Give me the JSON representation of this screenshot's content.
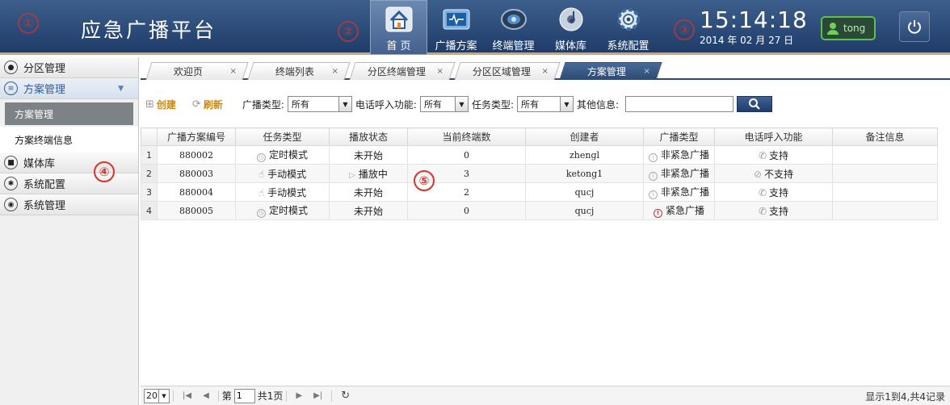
{
  "header": {
    "title": "应急广播平台",
    "markers": [
      "①",
      "②",
      "③"
    ],
    "nav": [
      {
        "label": "首 页",
        "icon": "home-icon",
        "active": true
      },
      {
        "label": "广播方案",
        "icon": "broadcast-plan-icon"
      },
      {
        "label": "终端管理",
        "icon": "terminal-icon"
      },
      {
        "label": "媒体库",
        "icon": "media-library-icon"
      },
      {
        "label": "系统配置",
        "icon": "settings-gear-icon"
      }
    ],
    "time": "15:14:18",
    "date": "2014 年 02 月 27 日",
    "user": "tong",
    "accent": "#d6a36b"
  },
  "sidebar": {
    "groups": [
      {
        "label": "分区管理",
        "icon": "location-pin-icon"
      },
      {
        "label": "方案管理",
        "icon": "list-icon",
        "open": true,
        "items": [
          {
            "label": "方案管理",
            "active": true
          },
          {
            "label": "方案终端信息"
          }
        ]
      },
      {
        "label": "媒体库",
        "icon": "camera-icon"
      },
      {
        "label": "系统配置",
        "icon": "gear-icon"
      },
      {
        "label": "系统管理",
        "icon": "eye-icon"
      }
    ],
    "marker": "④"
  },
  "tabs": [
    {
      "label": "欢迎页"
    },
    {
      "label": "终端列表"
    },
    {
      "label": "分区终端管理"
    },
    {
      "label": "分区区域管理"
    },
    {
      "label": "方案管理",
      "active": true
    }
  ],
  "tab_close": "×",
  "toolbar": {
    "create": "创建",
    "refresh": "刷新",
    "broadcast_type_label": "广播类型:",
    "broadcast_type_value": "所有",
    "phone_label": "电话呼入功能:",
    "phone_value": "所有",
    "task_type_label": "任务类型:",
    "task_type_value": "所有",
    "other_label": "其他信息:",
    "other_value": ""
  },
  "grid": {
    "columns": [
      "广播方案编号",
      "任务类型",
      "播放状态",
      "当前终端数",
      "创建者",
      "广播类型",
      "电话呼入功能",
      "备注信息"
    ],
    "rows": [
      {
        "no": "1",
        "id": "880002",
        "task": "定时模式",
        "task_icon": "clock",
        "status": "未开始",
        "status_icon": "",
        "count": "0",
        "creator": "zhengl",
        "btype": "非紧急广播",
        "btype_icon": "info",
        "phone": "支持",
        "phone_icon": "phone",
        "note": ""
      },
      {
        "no": "2",
        "id": "880003",
        "task": "手动模式",
        "task_icon": "hand",
        "status": "播放中",
        "status_icon": "play",
        "count": "3",
        "creator": "ketong1",
        "btype": "非紧急广播",
        "btype_icon": "info",
        "phone": "不支持",
        "phone_icon": "ban",
        "note": ""
      },
      {
        "no": "3",
        "id": "880004",
        "task": "手动模式",
        "task_icon": "hand",
        "status": "未开始",
        "status_icon": "",
        "count": "2",
        "creator": "qucj",
        "btype": "非紧急广播",
        "btype_icon": "info",
        "phone": "支持",
        "phone_icon": "phone",
        "note": ""
      },
      {
        "no": "4",
        "id": "880005",
        "task": "定时模式",
        "task_icon": "clock",
        "status": "未开始",
        "status_icon": "",
        "count": "0",
        "creator": "qucj",
        "btype": "紧急广播",
        "btype_icon": "alert",
        "phone": "支持",
        "phone_icon": "phone",
        "note": ""
      }
    ],
    "marker": "⑤"
  },
  "footer": {
    "page_size": "20",
    "page_prefix": "第",
    "page_value": "1",
    "page_suffix": "共1页",
    "info": "显示1到4,共4记录"
  }
}
